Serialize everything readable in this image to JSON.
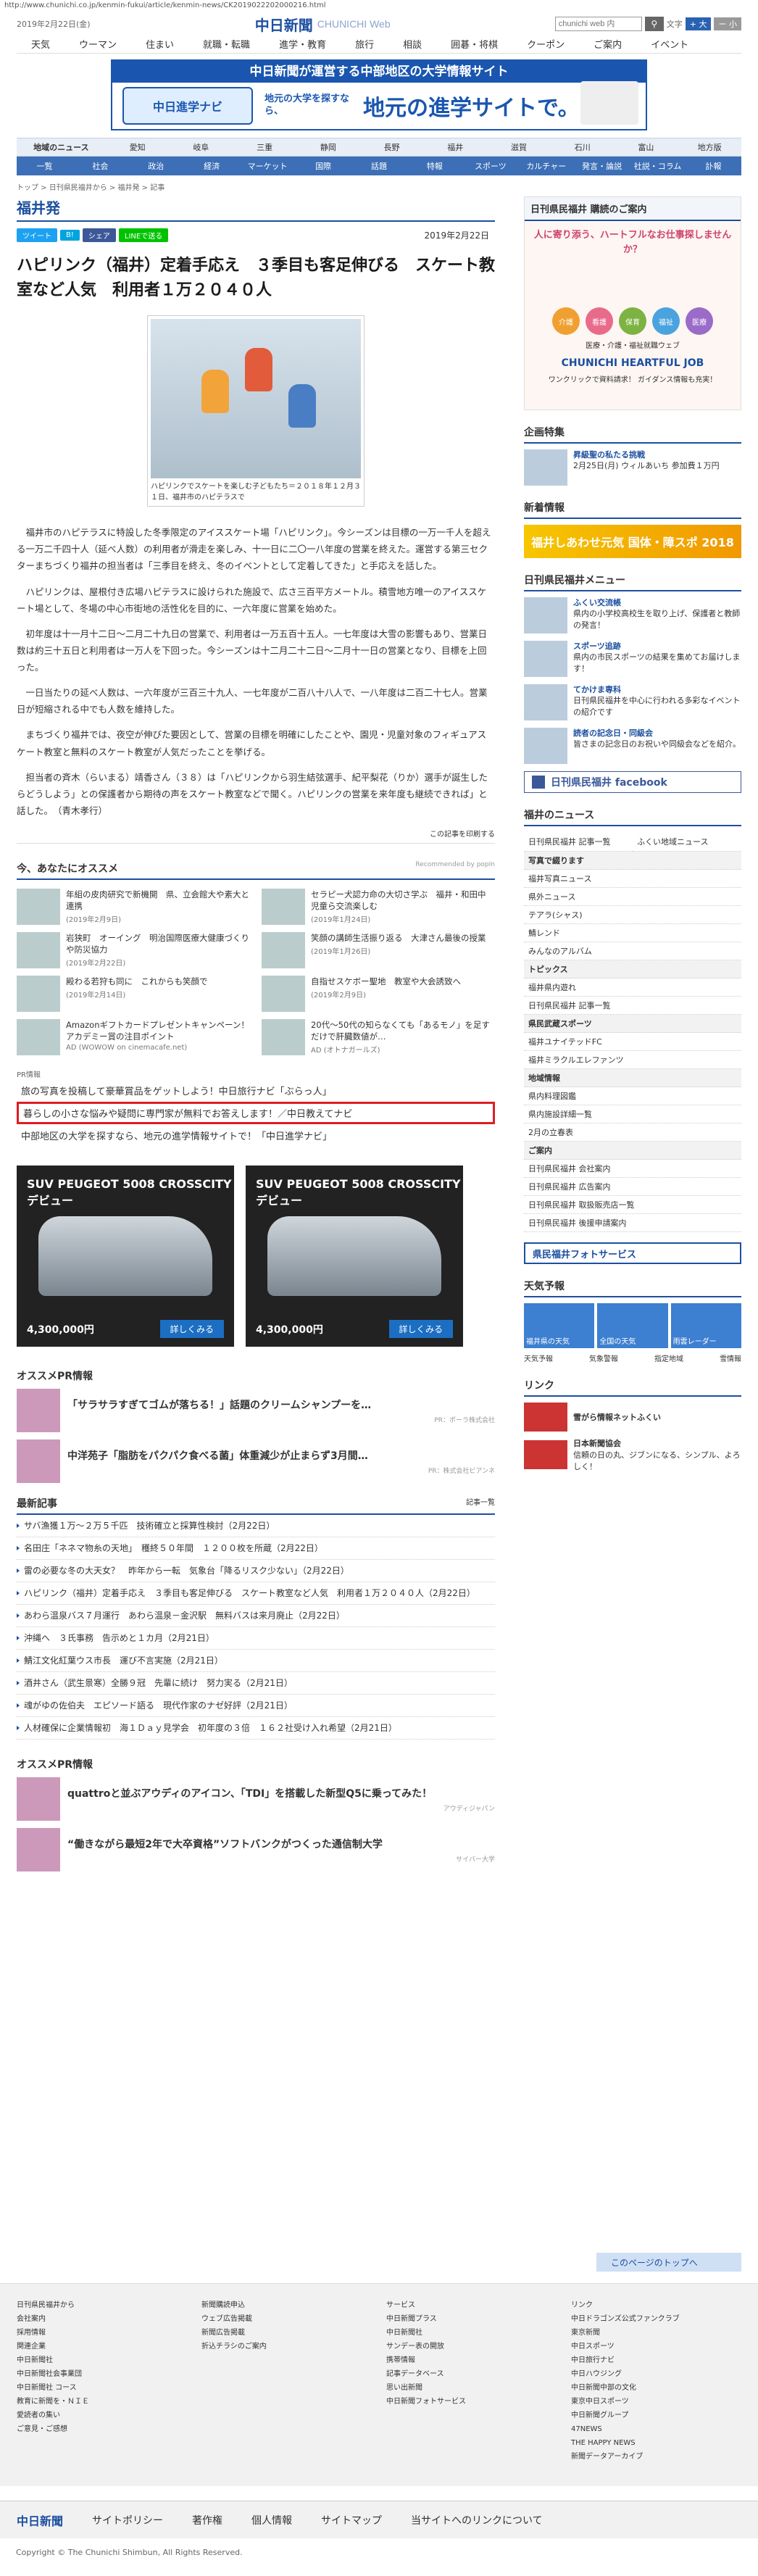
{
  "url": "http://www.chunichi.co.jp/kenmin-fukui/article/kenmin-news/CK2019022202000216.html",
  "header": {
    "date": "2019年2月22日(金)",
    "logo": "中日新聞",
    "logo_sub": "CHUNICHI Web",
    "search_placeholder": "chunichi web 内",
    "font_label": "文字",
    "font_large": "+ 大",
    "font_small": "ー 小"
  },
  "mainnav": [
    "天気",
    "ウーマン",
    "住まい",
    "就職・転職",
    "進学・教育",
    "旅行",
    "相談",
    "囲碁・将棋",
    "クーポン",
    "ご案内",
    "イベント"
  ],
  "banner": {
    "top": "中日新聞が運営する中部地区の大学情報サイト",
    "badge": "中日進学ナビ",
    "sub": "地元の大学を探すなら、",
    "big": "地元の進学サイトで。"
  },
  "regnav": [
    "地域のニュース",
    "愛知",
    "岐阜",
    "三重",
    "静岡",
    "長野",
    "福井",
    "滋賀",
    "石川",
    "富山",
    "地方版"
  ],
  "catnav": [
    "一覧",
    "社会",
    "政治",
    "経済",
    "マーケット",
    "国際",
    "話題",
    "特報",
    "スポーツ",
    "カルチャー",
    "発言・論説",
    "社説・コラム",
    "訃報"
  ],
  "crumb": "トップ > 日刊県民福井から > 福井発 > 記事",
  "section": "福井発",
  "social": [
    "ツイート",
    "B!",
    "シェア",
    "LINEで送る"
  ],
  "article": {
    "date": "2019年2月22日",
    "title": "ハピリンク（福井）定着手応え　３季目も客足伸びる　スケート教室など人気　利用者１万２０４０人",
    "caption": "ハピリンクでスケートを楽しむ子どもたち＝２０１８年１２月３１日、福井市のハピテラスで",
    "paras": [
      "福井市のハピテラスに特設した冬季限定のアイススケート場「ハピリンク」。今シーズンは目標の一万一千人を超える一万二千四十人（延べ人数）の利用者が滑走を楽しみ、十一日に二〇一八年度の営業を終えた。運営する第三セクターまちづくり福井の担当者は「三季目を終え、冬のイベントとして定着してきた」と手応えを話した。",
      "ハピリンクは、屋根付き広場ハピテラスに設けられた施設で、広さ三百平方メートル。積雪地方唯一のアイススケート場として、冬場の中心市街地の活性化を目的に、一六年度に営業を始めた。",
      "初年度は十一月十二日～二月二十九日の営業で、利用者は一万五百十五人。一七年度は大雪の影響もあり、営業日数は約三十五日と利用者は一万人を下回った。今シーズンは十二月二十二日～二月十一日の営業となり、目標を上回った。",
      "一日当たりの延べ人数は、一六年度が三百三十九人、一七年度が二百八十八人で、一八年度は二百二十七人。営業日が短縮される中でも人数を維持した。",
      "まちづくり福井では、夜空が伸びた要因として、営業の目標を明確にしたことや、園児・児童対象のフィギュアスケート教室と無料のスケート教室が人気だったことを挙げる。",
      "担当者の斉木（らいまる）靖香さん（３８）は「ハピリンクから羽生結弦選手、紀平梨花（りか）選手が誕生したらどうしよう」との保護者から期待の声をスケート教室などで聞く。ハピリンクの営業を来年度も継続できれば」と話した。　（青木孝行）"
    ]
  },
  "print": "この記事を印刷する",
  "osusume": {
    "title": "今、あなたにオススメ",
    "rec": "Recommended by popIn",
    "items": [
      {
        "t": "年組の皮肉研究で新機開　県、立会館大や素大と連携",
        "d": "(2019年2月9日)"
      },
      {
        "t": "セラピー犬認力命の大切さ学ぶ　福井・和田中　児童ら交流楽しむ",
        "d": "(2019年1月24日)"
      },
      {
        "t": "岩狭町　オーイング　明治国際医療大健康づくりや防災協力",
        "d": "(2019年2月22日)"
      },
      {
        "t": "笑顔の講師生活振り返る　大津さん最後の授業",
        "d": "(2019年1月26日)"
      },
      {
        "t": "殿わる若狩も同に　これからも笑顔で",
        "d": "(2019年2月14日)"
      },
      {
        "t": "自指せスケボー聖地　教室や大会誘致へ",
        "d": "(2019年2月9日)"
      },
      {
        "t": "Amazonギフトカードプレゼントキャンペーン！アカデミー賞の注目ポイント",
        "d": "AD (WOWOW on cinemacafe.net)"
      },
      {
        "t": "20代～50代の知らなくても「あるモノ」を足すだけで肝臓数値が…",
        "d": "AD (オトナガールズ)"
      }
    ]
  },
  "pr": {
    "label": "PR情報",
    "lines": [
      "旅の写真を投稿して豪華賞品をゲットしよう！中日旅行ナビ「ぶらっ人」",
      "暮らしの小さな悩みや疑問に専門家が無料でお答えします！／中日教えてナビ",
      "中部地区の大学を探すなら、地元の進学情報サイトで！「中日進学ナビ」"
    ]
  },
  "ads": [
    {
      "t": "SUV PEUGEOT 5008 CROSSCITY デビュー",
      "price": "4,300,000円",
      "more": "詳しくみる"
    },
    {
      "t": "SUV PEUGEOT 5008 CROSSCITY デビュー",
      "price": "4,300,000円",
      "more": "詳しくみる"
    }
  ],
  "prinfo": {
    "title": "オススメPR情報",
    "items": [
      {
        "t": "「サラサラすぎてゴムが落ちる！」話題のクリームシャンプーを…",
        "s": "PR：ポーラ株式会社"
      },
      {
        "t": "中洋苑子「脂肪をパクパク食べる菌」体重減少が止まらず3月間…",
        "s": "PR：株式会社ビアンネ"
      }
    ]
  },
  "latest": {
    "title": "最新記事",
    "more": "記事一覧",
    "items": [
      "サバ漁獲１万～２万５千匹　技術確立と採算性検討（2月22日）",
      "名田庄「ネネマ物糸の天地」　穫終５０年間　１２００枚を所蔵（2月22日）",
      "雷の必要な冬の大天女？　昨年から一転　気象台「降るリスク少ない」（2月22日）",
      "ハピリンク（福井）定着手応え　３季目も客足伸びる　スケート教室など人気　利用者１万２０４０人（2月22日）",
      "あわら温泉バス７月運行　あわら温泉－金沢駅　無料バスは来月廃止（2月22日）",
      "沖縄へ　３氏事務　告示めと１カ月（2月21日）",
      "鯖江文化紅葉ウス市長　運び不言実施（2月21日）",
      "酒井さん（武生景寒）全勝９冠　先輩に続け　努力実る（2月21日）",
      "魂がゆの佐伯夫　エピソード語る　現代作家のナゼ好評（2月21日）",
      "人材確保に企業情報初　海１Ｄａｙ見学会　初年度の３倍　１６２社受け入れ希望（2月21日）"
    ]
  },
  "pr2": {
    "title": "オススメPR情報",
    "items": [
      {
        "t": "quattroと並ぶアウディのアイコン、「TDI」を搭載した新型Q5に乗ってみた！",
        "s": "アウディジャパン"
      },
      {
        "t": "“働きながら最短2年で大卒資格”ソフトバンクがつくった通信制大学",
        "s": "サイバー大学"
      }
    ]
  },
  "side": {
    "kenmin": "日刊県民福井 購読のご案内",
    "heart_q": "人に寄り添う、ハートフルなお仕事探しませんか？",
    "heart_circles": [
      "介護",
      "看護",
      "保育",
      "福祉",
      "医療"
    ],
    "heart_job": "CHUNICHI HEARTFUL JOB",
    "heart_sub": "医療・介護・福祉就職ウェブ",
    "heart_sub2": "ワンクリックで資料請求！ ガイダンス情報も充実！",
    "special": "企画特集",
    "special_item": {
      "t": "昇級聖の私たる挑戦",
      "d": "2月25日(月) ウィルあいち 参加費１万円"
    },
    "newest": "新着情報",
    "newest_ban": "福井しあわせ元気 国体・障スポ 2018",
    "menu": "日刊県民福井メニュー",
    "menu_items": [
      {
        "b": "ふくい交流帳",
        "t": "県内の小学校高校生を取り上げ、保護者と教師の発言！"
      },
      {
        "b": "スポーツ追跡",
        "t": "県内の市民スポーツの結果を集めてお届けします！"
      },
      {
        "b": "てかけま専科",
        "t": "日刊県民福井を中心に行われる多彩なイベントの紹介です"
      },
      {
        "b": "読者の記念日・同級会",
        "t": "皆さまの記念日のお祝いや同級会などを紹介。"
      }
    ],
    "fb": "日刊県民福井 facebook",
    "fukui_news": "福井のニュース",
    "news_tabs": [
      "日刊県民福井 記事一覧",
      "ふくい地域ニュース"
    ],
    "photo_t": "写真で綴ります",
    "photo_tabs": [
      "福井写真ニュース",
      "県外ニュース",
      "テアラ(シャス)",
      "鯖レンド",
      "みんなのアルバム"
    ],
    "topics": "トピックス",
    "topics_tabs": [
      "福井県内遊れ",
      "日刊県民福井 記事一覧"
    ],
    "sports": "県民武蔵スポーツ",
    "sports_tabs": [
      "福井ユナイテッドFC",
      "福井ミラクルエレファンツ"
    ],
    "local": "地域情報",
    "local_tabs": [
      "県内料理図鑑",
      "県内施設詳細一覧",
      "2月の立春表"
    ],
    "guide": "ご案内",
    "guide_items": [
      "日刊県民福井 会社案内",
      "日刊県民福井 広告案内",
      "日刊県民福井 取扱販売店一覧",
      "日刊県民福井 後援申請案内"
    ],
    "photo_svc": "県民福井フォトサービス",
    "weather": "天気予報",
    "weather_tiles": [
      "福井県の天気",
      "全国の天気",
      "雨雲レーダー"
    ],
    "weather_links": [
      "天気予報",
      "気象警報",
      "指定地域",
      "雪情報"
    ],
    "link": "リンク",
    "link_items": [
      {
        "t": "雪がら情報ネットふくい",
        "d": ""
      },
      {
        "t": "日本新聞協会",
        "d": "信頼の日の丸、ジブンになる、シンプル、よろしく！"
      }
    ]
  },
  "totop": "このページのトップへ",
  "footer": [
    [
      "日刊県民福井から",
      "会社案内",
      "採用情報",
      "関連企業",
      "中日新聞社",
      "中日新聞社会事業団",
      "中日新聞社 コース",
      "教育に新聞を・ＮＩＥ",
      "愛読者の集い",
      "ご意見・ご感想"
    ],
    [
      "新聞購読申込",
      "ウェブ広告掲載",
      "新聞広告掲載",
      "折込チラシのご案内"
    ],
    [
      "サービス",
      "中日新聞プラス",
      "中日新聞社",
      "サンデー表の開放",
      "携帯情報",
      "記事データベース",
      "思い出新聞",
      "中日新聞フォトサービス"
    ],
    [
      "リンク",
      "中日ドラゴンズ公式ファンクラブ",
      "東京新聞",
      "中日スポーツ",
      "中日旅行ナビ",
      "中日ハウジング",
      "中日新聞中部の文化",
      "東京中日スポーツ",
      "中日新聞グループ",
      "47NEWS",
      "THE HAPPY NEWS",
      "新聞データアーカイブ"
    ]
  ],
  "fbar": {
    "logo": "中日新聞",
    "links": [
      "サイトポリシー",
      "著作権",
      "個人情報",
      "サイトマップ",
      "当サイトへのリンクについて"
    ]
  },
  "copyright": "Copyright © The Chunichi Shimbun, All Rights Reserved."
}
